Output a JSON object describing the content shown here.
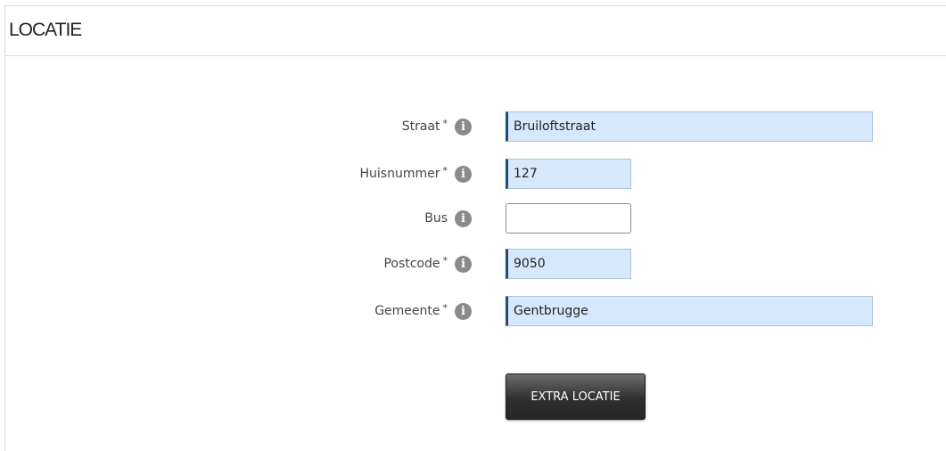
{
  "section": {
    "title": "LOCATIE"
  },
  "fields": [
    {
      "label": "Straat",
      "required_mark": "*",
      "value": "Bruiloftstraat",
      "icon": "info-icon"
    },
    {
      "label": "Huisnummer",
      "required_mark": "*",
      "value": "127",
      "icon": "info-icon"
    },
    {
      "label": "Bus",
      "required_mark": "",
      "value": "",
      "icon": "info-icon"
    },
    {
      "label": "Postcode",
      "required_mark": "*",
      "value": "9050",
      "icon": "info-icon"
    },
    {
      "label": "Gemeente",
      "required_mark": "*",
      "value": "Gentbrugge",
      "icon": "info-icon"
    }
  ],
  "info_glyph": "i",
  "actions": {
    "extra_location_label": "EXTRA LOCATIE"
  },
  "colors": {
    "filled_input_bg": "#d6e8fb",
    "input_accent": "#1f4e7a",
    "button_bg": "#2f2f2f"
  }
}
